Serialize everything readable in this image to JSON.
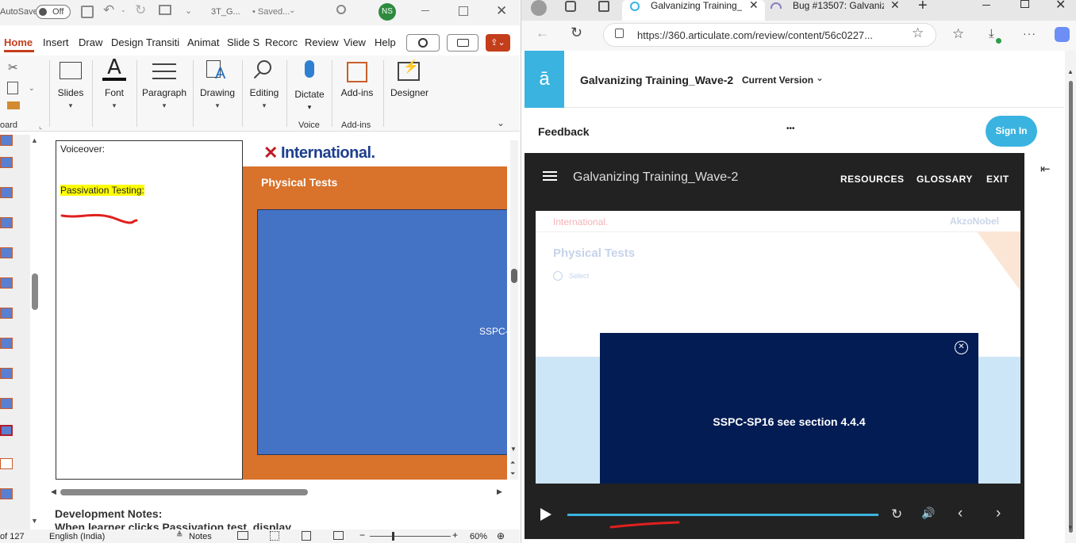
{
  "ppt": {
    "title": {
      "autosave": "AutoSave",
      "autosave_state": "Off",
      "filename": "3T_G...",
      "saved": "• Saved...",
      "user_initials": "NS"
    },
    "tabs": [
      "Home",
      "Insert",
      "Draw",
      "Design",
      "Transiti",
      "Animat",
      "Slide S",
      "Recorc",
      "Review",
      "View",
      "Help"
    ],
    "ribbon": {
      "clipboard_label": "oard",
      "groups": [
        {
          "name": "slides",
          "label": "Slides"
        },
        {
          "name": "font",
          "label": "Font"
        },
        {
          "name": "paragraph",
          "label": "Paragraph"
        },
        {
          "name": "drawing",
          "label": "Drawing"
        },
        {
          "name": "editing",
          "label": "Editing"
        },
        {
          "name": "dictate",
          "label": "Dictate"
        },
        {
          "name": "addins",
          "label": "Add-ins"
        },
        {
          "name": "designer",
          "label": "Designer"
        }
      ],
      "voice_group": "Voice",
      "addins_group": "Add-ins"
    },
    "notes_box": {
      "voiceover": "Voiceover:",
      "highlight": "Passivation Testing:"
    },
    "slide": {
      "logo": "International.",
      "heading": "Physical Tests",
      "cut_text": "SSPC-S"
    },
    "dev_notes": {
      "title": "Development Notes:",
      "line": "When learner clicks Passivation test, display"
    },
    "status": {
      "page": "of 127",
      "language": "English (India)",
      "notes": "Notes",
      "zoom": "60%"
    },
    "colors": {
      "accent": "#c43e1c",
      "slide_orange": "#d9722b",
      "slide_blue": "#4472c4"
    }
  },
  "edge": {
    "tabs": [
      {
        "label": "Galvanizing Training_W",
        "active": true
      },
      {
        "label": "Bug #13507: Galvaniz",
        "active": false
      }
    ],
    "url": "https://360.articulate.com/review/content/56c0227...",
    "review": {
      "logo_letter": "ā",
      "course_title": "Galvanizing Training_Wave-2",
      "version": "Current Version",
      "feedback": "Feedback",
      "more": "•••",
      "sign_in": "Sign In"
    },
    "player": {
      "title": "Galvanizing Training_Wave-2",
      "nav": [
        "RESOURCES",
        "GLOSSARY",
        "EXIT"
      ],
      "brand_left": "International.",
      "brand_right": "AkzoNobel",
      "slide_heading": "Physical Tests",
      "slide_instruction": "Select",
      "modal_text": "SSPC-SP16 see section 4.4.4"
    },
    "colors": {
      "accent": "#3ab3e0",
      "modal_bg": "#031c54",
      "sign_in": "#3ab3e0"
    }
  }
}
